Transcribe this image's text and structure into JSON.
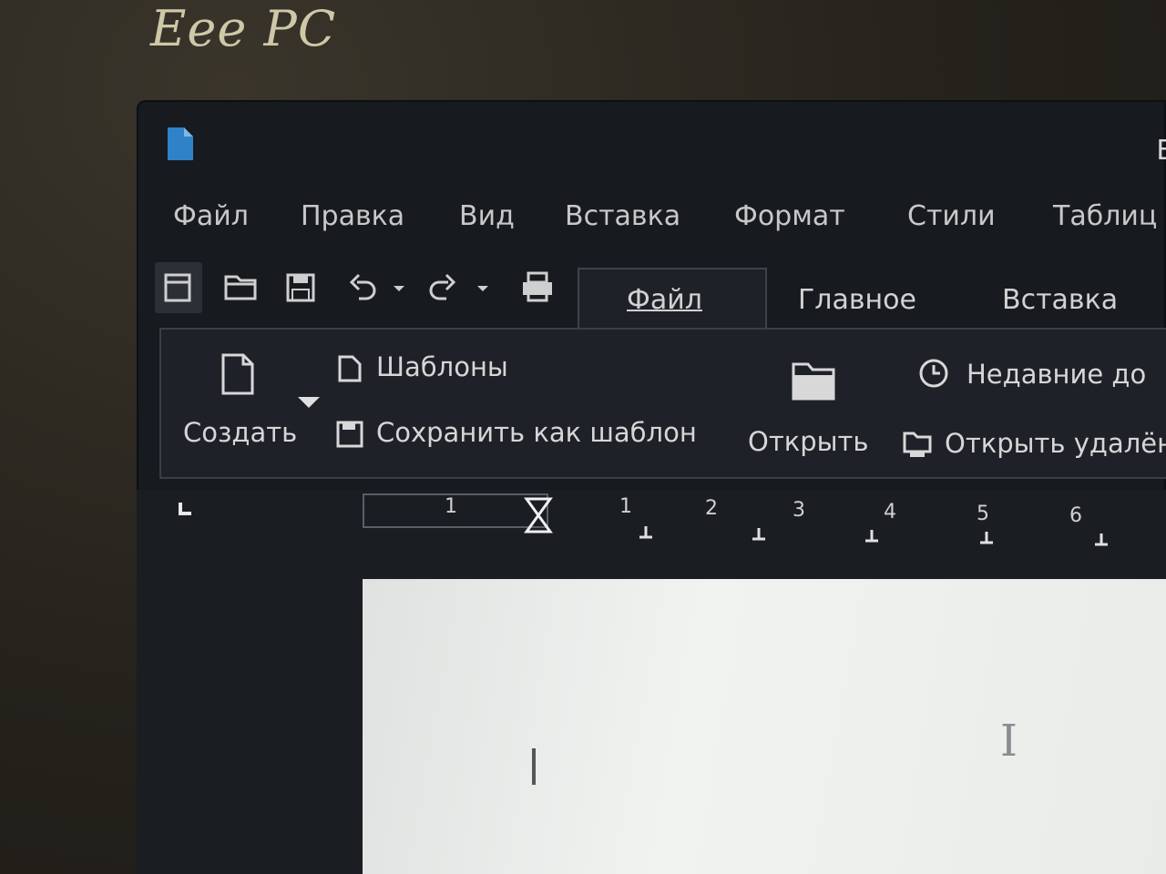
{
  "bezel": {
    "brand": "Eee PC"
  },
  "window": {
    "title_fragment": "Б"
  },
  "menu": [
    {
      "label": "Файл"
    },
    {
      "label": "Правка"
    },
    {
      "label": "Вид"
    },
    {
      "label": "Вставка"
    },
    {
      "label": "Формат"
    },
    {
      "label": "Стили"
    },
    {
      "label": "Таблиц"
    }
  ],
  "quick_toolbar": [
    {
      "icon": "new-document-icon"
    },
    {
      "icon": "open-folder-icon"
    },
    {
      "icon": "save-icon"
    },
    {
      "icon": "undo-icon"
    },
    {
      "icon": "undo-dropdown-icon"
    },
    {
      "icon": "redo-icon"
    },
    {
      "icon": "redo-dropdown-icon"
    },
    {
      "icon": "print-icon"
    }
  ],
  "tabs": [
    {
      "label": "Файл",
      "active": true
    },
    {
      "label": "Главное",
      "active": false
    },
    {
      "label": "Вставка",
      "active": false
    }
  ],
  "ribbon": {
    "create_label": "Создать",
    "templates_label": "Шаблоны",
    "save_as_template_label": "Сохранить как шаблон",
    "open_label": "Открыть",
    "recent_label": "Недавние до",
    "open_remote_label": "Открыть удалён"
  },
  "ruler": {
    "numbers": [
      "1",
      "1",
      "2",
      "3",
      "4",
      "5",
      "6"
    ]
  },
  "colors": {
    "screen_bg": "#171a1f",
    "ribbon_bg": "#1e2127",
    "doc_icon": "#2f82c8",
    "page": "#eef0ee"
  }
}
